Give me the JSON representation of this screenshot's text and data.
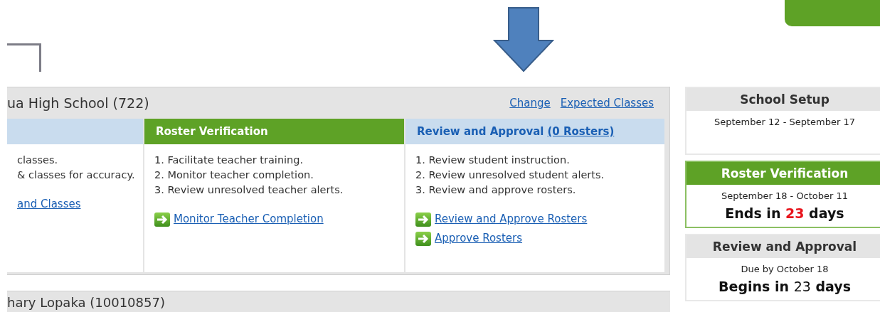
{
  "top_button": {
    "kind": "button"
  },
  "school_panel": {
    "title": "ua High School (722)",
    "links": [
      "Change",
      "Expected Classes"
    ],
    "steps": [
      {
        "current": false,
        "items": [
          "classes.",
          "& classes for accuracy."
        ],
        "actions": [
          "and Classes"
        ],
        "action_icons": false
      },
      {
        "title": "Roster Verification",
        "current": true,
        "items": [
          "1. Facilitate teacher training.",
          "2. Monitor teacher completion.",
          "3. Review unresolved teacher alerts."
        ],
        "actions": [
          "Monitor Teacher Completion"
        ],
        "action_icons": true
      },
      {
        "title": "Review and Approval",
        "link": "(0 Rosters)",
        "current": false,
        "items": [
          "1. Review student instruction.",
          "2. Review unresolved student alerts.",
          "3. Review and approve rosters."
        ],
        "actions": [
          "Review and Approve Rosters",
          "Approve Rosters"
        ],
        "action_icons": true
      }
    ]
  },
  "next_panel": {
    "title": "hary Lopaka (10010857)"
  },
  "timeline": [
    {
      "title": "School Setup",
      "current": false,
      "dates": "September 12 - September 17"
    },
    {
      "title": "Roster Verification",
      "current": true,
      "dates": "September 18 - October 11",
      "countdown": {
        "before": "Ends in",
        "number": "23",
        "after": "days",
        "alert": true
      }
    },
    {
      "title": "Review and Approval",
      "current": false,
      "dates": "Due by October 18",
      "countdown": {
        "before": "Begins in",
        "number": "23",
        "after": "days",
        "alert": false
      }
    }
  ]
}
